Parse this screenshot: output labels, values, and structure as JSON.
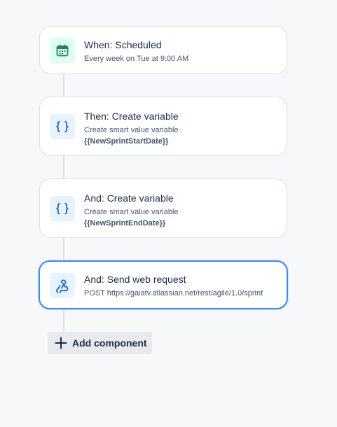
{
  "flow": {
    "components": [
      {
        "title": "When: Scheduled",
        "subtitle": "Every week on Tue at 9:00 AM",
        "icon": "calendar-icon",
        "icon_color": "#1f845a",
        "icon_bg": "#dcfff1"
      },
      {
        "title": "Then: Create variable",
        "subtitle": "Create smart value variable",
        "detail": "{{NewSprintStartDate}}",
        "icon": "curly-braces-icon",
        "icon_color": "#0c66e4",
        "icon_bg": "#e9f2ff"
      },
      {
        "title": "And: Create variable",
        "subtitle": "Create smart value variable",
        "detail": "{{NewSprintEndDate}}",
        "icon": "curly-braces-icon",
        "icon_color": "#0c66e4",
        "icon_bg": "#e9f2ff"
      },
      {
        "title": "And: Send web request",
        "subtitle": "POST https://gaiatv.atlassian.net/rest/agile/1.0/sprint",
        "icon": "webhook-icon",
        "icon_color": "#0c66e4",
        "icon_bg": "#e9f2ff",
        "selected": true
      }
    ],
    "add_button": {
      "label": "Add component",
      "icon": "plus-icon"
    }
  },
  "colors": {
    "selected_border": "#388bff",
    "connector": "#dcdfe4",
    "background": "#f7f8f9"
  }
}
